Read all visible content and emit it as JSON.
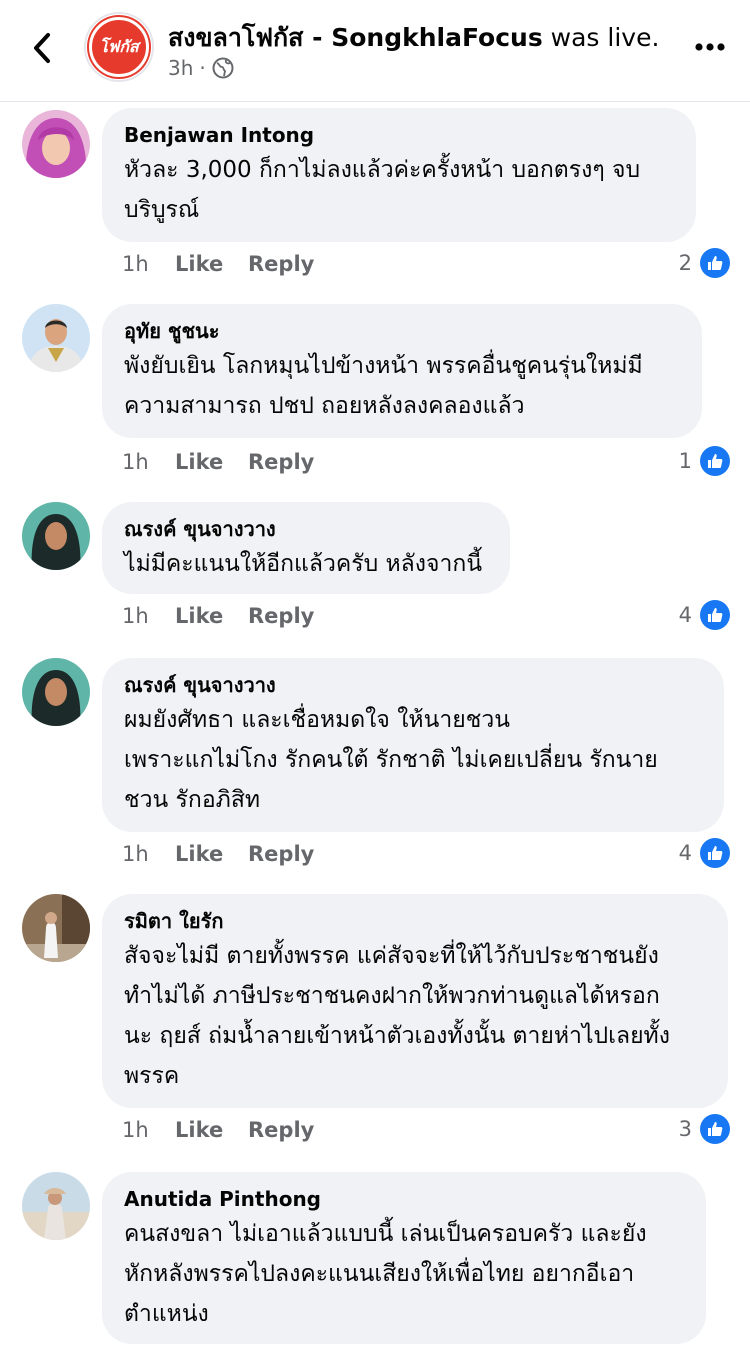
{
  "header": {
    "page_name": "สงขลาโฟกัส - SongkhlaFocus",
    "suffix": " was live.",
    "time": "3h",
    "separator": "·",
    "avatar_text": "โฟกัส",
    "icons": {
      "back": "chevron-left-icon",
      "privacy": "globe-icon",
      "more": "more-horizontal-icon"
    }
  },
  "comments": [
    {
      "author": "Benjawan Intong",
      "lines": [
        "หัวละ 3,000 ก็กาไม่ลงแล้วค่ะครั้งหน้า บอกตรงๆ จบ",
        "บริบูรณ์"
      ],
      "time": "1h",
      "like": "Like",
      "reply": "Reply",
      "reactions": "2"
    },
    {
      "author": "อุทัย ชูชนะ",
      "lines": [
        "พังยับเยิน โลกหมุนไปข้างหน้า พรรคอื่นชูคนรุ่นใหม่มี",
        "ความสามารถ ปชป ถอยหลังลงคลองแล้ว"
      ],
      "time": "1h",
      "like": "Like",
      "reply": "Reply",
      "reactions": "1"
    },
    {
      "author": "ณรงค์ ขุนจางวาง",
      "lines": [
        "ไม่มีคะแนนให้อีกแล้วครับ หลังจากนี้"
      ],
      "time": "1h",
      "like": "Like",
      "reply": "Reply",
      "reactions": "4"
    },
    {
      "author": "ณรงค์ ขุนจางวาง",
      "lines": [
        "ผมยังศัทธา และเชื่อหมดใจ ให้นายชวน",
        "เพราะแกไม่โกง  รักคนใต้ รักชาติ ไม่เคยเปลี่ยน รักนาย",
        "ชวน รักอภิสิท"
      ],
      "time": "1h",
      "like": "Like",
      "reply": "Reply",
      "reactions": "4"
    },
    {
      "author": "รมิตา ใยรัก",
      "lines": [
        "สัจจะไม่มี ตายทั้งพรรค แค่สัจจะที่ให้ไว้กับประชาชนยัง",
        "ทำไม่ได้ ภาษีประชาชนคงฝากให้พวกท่านดูแลได้หรอก",
        "นะ ฤยส์ ถ่มน้ำลายเข้าหน้าตัวเองทั้งนั้น ตายห่าไปเลยทั้ง",
        "พรรค"
      ],
      "time": "1h",
      "like": "Like",
      "reply": "Reply",
      "reactions": "3"
    },
    {
      "author": "Anutida Pinthong",
      "lines": [
        "คนสงขลา ไม่เอาแล้วแบบนี้ เล่นเป็นครอบครัว และยัง",
        "หักหลังพรรคไปลงคะแนนเสียงให้เพื่อไทย อยากอีเอา",
        "ตำแหน่ง"
      ]
    }
  ],
  "colors": {
    "bubble": "#f0f2f5",
    "meta": "#65676b",
    "like_blue": "#1877f2",
    "brand_red": "#e63a2c"
  }
}
